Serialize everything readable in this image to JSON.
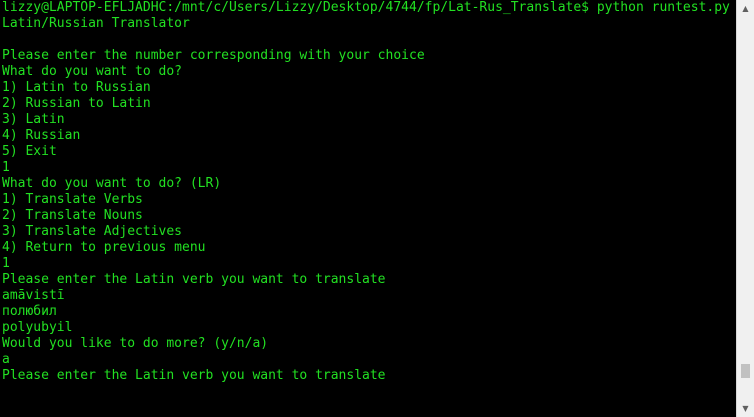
{
  "terminal": {
    "lines": [
      "lizzy@LAPTOP-EFLJADHC:/mnt/c/Users/Lizzy/Desktop/4744/fp/Lat-Rus_Translate$ python runtest.py",
      "Latin/Russian Translator",
      "",
      "Please enter the number corresponding with your choice",
      "What do you want to do?",
      "1) Latin to Russian",
      "2) Russian to Latin",
      "3) Latin",
      "4) Russian",
      "5) Exit",
      "1",
      "What do you want to do? (LR)",
      "1) Translate Verbs",
      "2) Translate Nouns",
      "3) Translate Adjectives",
      "4) Return to previous menu",
      "1",
      "Please enter the Latin verb you want to translate",
      "amāvistī",
      "полюбил",
      "polyubyil",
      "Would you like to do more? (y/n/a)",
      "a",
      "Please enter the Latin verb you want to translate"
    ],
    "text_color": "#22e022",
    "background_color": "#000000"
  },
  "scrollbar": {
    "up_icon": "triangle-up",
    "down_icon": "triangle-down",
    "position": 0.94
  }
}
